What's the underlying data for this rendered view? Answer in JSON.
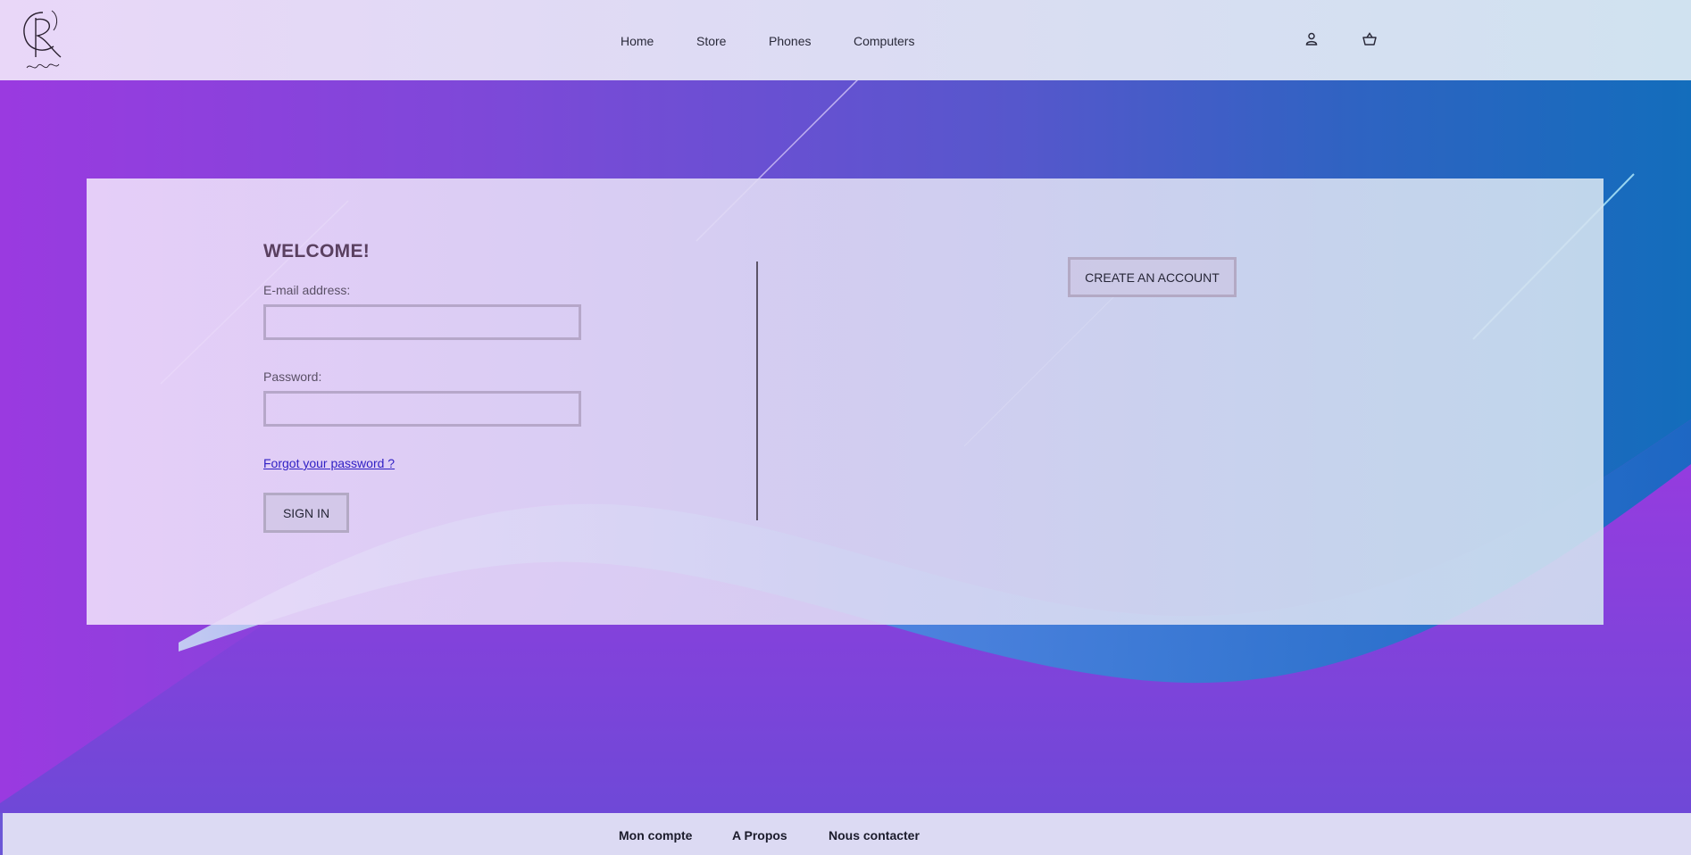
{
  "brand": {
    "logo_icon": "cr-monogram-logo-icon"
  },
  "nav": {
    "items": [
      {
        "label": "Home"
      },
      {
        "label": "Store"
      },
      {
        "label": "Phones"
      },
      {
        "label": "Computers"
      }
    ],
    "account_icon": "user-icon",
    "cart_icon": "basket-icon"
  },
  "login": {
    "title": "WELCOME!",
    "email_label": "E-mail address:",
    "email_value": "",
    "password_label": "Password:",
    "password_value": "",
    "forgot_link": "Forgot your password ?",
    "sign_in_label": "SIGN IN"
  },
  "register": {
    "create_account_label": "CREATE AN ACCOUNT"
  },
  "footer": {
    "items": [
      {
        "label": "Mon compte"
      },
      {
        "label": "A Propos"
      },
      {
        "label": "Nous contacter"
      }
    ]
  },
  "colors": {
    "accent_purple": "#9a3ae0",
    "accent_blue": "#136dbc",
    "link": "#2f1fc4"
  }
}
